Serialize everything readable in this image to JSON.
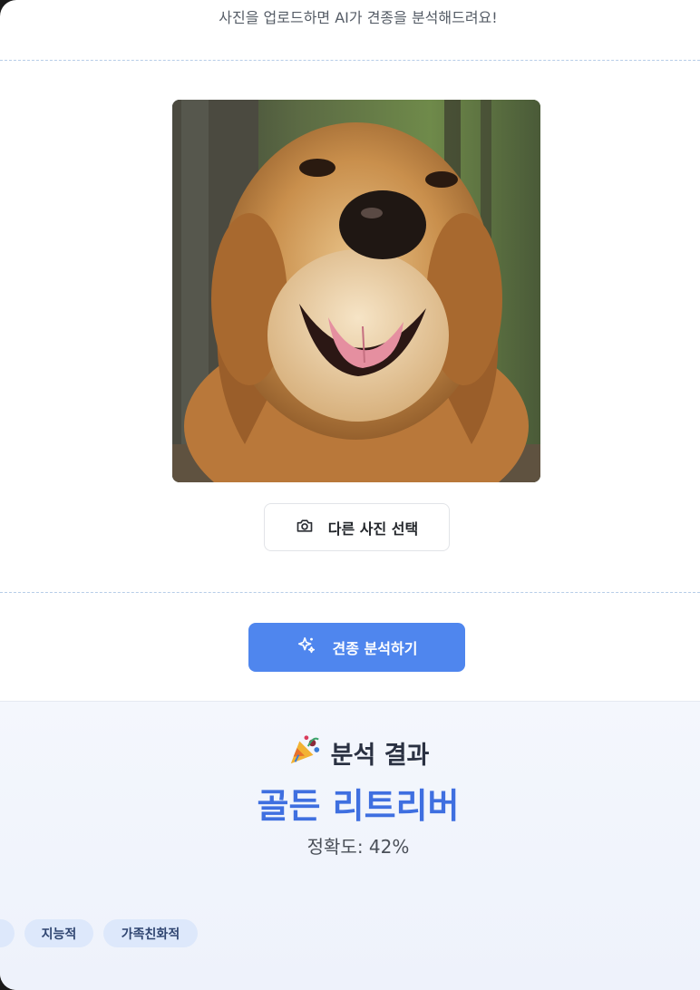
{
  "header": {
    "subtitle": "사진을 업로드하면 AI가 견종을 분석해드려요!"
  },
  "upload": {
    "photo_alt": "골든 리트리버 사진",
    "choose_label": "다른 사진 선택",
    "choose_icon": "camera-icon"
  },
  "analyze": {
    "label": "견종 분석하기",
    "icon": "sparkles-icon",
    "color": "#4f86ee"
  },
  "result": {
    "title": "분석 결과",
    "title_icon": "party-popper-icon",
    "breed": "골든 리트리버",
    "accuracy_text": "정확도: 42%",
    "accuracy_value": 42,
    "tags": [
      "",
      "지능적",
      "가족친화적"
    ]
  }
}
